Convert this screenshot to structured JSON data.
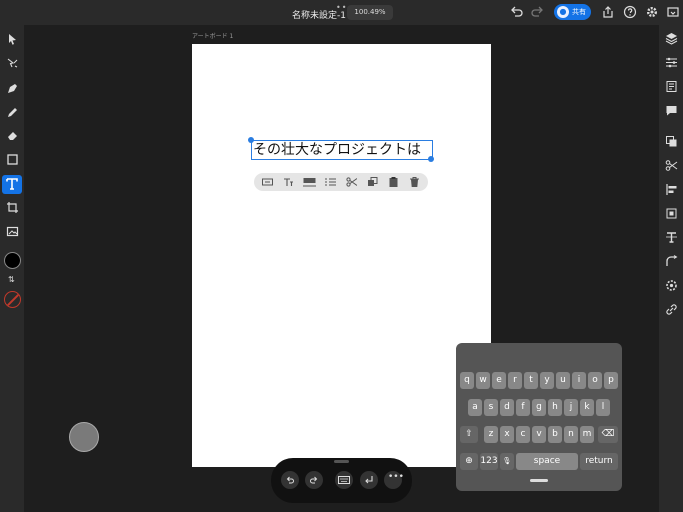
{
  "topbar": {
    "title": "名称未設定-1",
    "zoom": "100.49%",
    "share_label": "共有",
    "icons": [
      "more-dots-icon",
      "undo-icon",
      "redo-icon",
      "user-icon",
      "export-icon",
      "help-icon",
      "settings-icon",
      "preview-icon"
    ]
  },
  "toolbar": {
    "tools": [
      "select-tool",
      "direct-select-tool",
      "pen-tool",
      "pencil-tool",
      "eraser-tool",
      "shape-tool",
      "type-tool",
      "crop-tool",
      "image-tool",
      "fill-color",
      "swap-colors",
      "stroke-color"
    ]
  },
  "right_panel": {
    "icons": [
      "layers-icon",
      "properties-icon",
      "libraries-icon",
      "comments-icon",
      "copy-icon",
      "scissors-icon",
      "align-icon",
      "transform-icon",
      "text-icon",
      "pathfinder-icon",
      "effects-icon",
      "link-icon"
    ]
  },
  "artboard": {
    "label": "アートボード 1",
    "text": "その壮大なプロジェクトは",
    "background": "#ffffff",
    "selection_color": "#2a7de1"
  },
  "context_menu": {
    "icons": [
      "text-options-icon",
      "font-size-icon",
      "character-spacing-icon",
      "list-icon",
      "cut-icon",
      "duplicate-icon",
      "paste-icon",
      "delete-icon"
    ]
  },
  "keyboard": {
    "row1": [
      "q",
      "w",
      "e",
      "r",
      "t",
      "y",
      "u",
      "i",
      "o",
      "p"
    ],
    "row2": [
      "a",
      "s",
      "d",
      "f",
      "g",
      "h",
      "j",
      "k",
      "l"
    ],
    "row3": [
      "z",
      "x",
      "c",
      "v",
      "b",
      "n",
      "m"
    ],
    "numbers_label": "123",
    "space_label": "space",
    "return_label": "return"
  },
  "bottom_bar": {
    "icons": [
      "undo-icon",
      "redo-icon",
      "keyboard-icon",
      "enter-icon",
      "more-icon"
    ]
  },
  "colors": {
    "accent": "#1473e6",
    "panel": "#2a2a2a",
    "canvas": "#1e1e1e"
  }
}
